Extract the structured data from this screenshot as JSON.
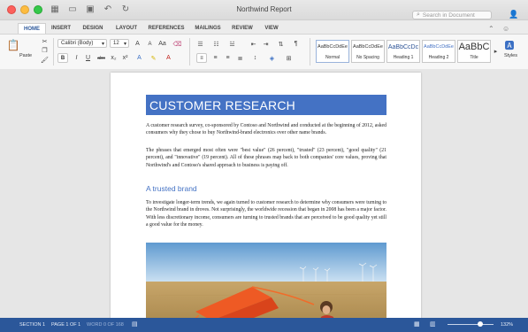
{
  "window": {
    "title": "Northwind Report"
  },
  "search": {
    "placeholder": "Search in Document"
  },
  "tabs": [
    {
      "label": "HOME"
    },
    {
      "label": "INSERT"
    },
    {
      "label": "DESIGN"
    },
    {
      "label": "LAYOUT"
    },
    {
      "label": "REFERENCES"
    },
    {
      "label": "MAILINGS"
    },
    {
      "label": "REVIEW"
    },
    {
      "label": "VIEW"
    }
  ],
  "ribbon": {
    "paste_label": "Paste",
    "font_name": "Calibri (Body)",
    "font_size": "12",
    "styles_label": "Styles",
    "style_gallery": [
      {
        "sample": "AaBbCcDdEe",
        "name": "Normal"
      },
      {
        "sample": "AaBbCcDdEe",
        "name": "No Spacing"
      },
      {
        "sample": "AaBbCcDc",
        "name": "Heading 1"
      },
      {
        "sample": "AaBbCcDdEe",
        "name": "Heading 2"
      },
      {
        "sample": "AaBbC",
        "name": "Title"
      }
    ]
  },
  "document": {
    "heading": "CUSTOMER RESEARCH",
    "p1": "A customer research survey, co-sponsored by Contoso and Northwind and conducted at the beginning of 2012, asked consumers why they chose to buy Northwind-brand electronics over other name brands.",
    "p2": "The phrases that emerged most often were \"best value\" (26 percent), \"trusted\" (23 percent), \"good quality\" (21 percent), and \"innovative\" (19 percent). All of these phrases map back to both companies' core values, proving that Northwind's and Contoso's shared approach to business is paying off.",
    "subheading": "A trusted brand",
    "p3": "To investigate longer-term trends, we again turned to customer research to determine why consumers were turning to the Northwind brand in droves. Not surprisingly, the worldwide recession that began in 2008 has been a major factor. With less discretionary income, consumers are turning to trusted brands that are perceived to be good quality yet still a good value for the money."
  },
  "status": {
    "section": "SECTION 1",
    "page": "PAGE 1 OF 1",
    "words": "WORD 0 OF 168",
    "zoom": "132%",
    "zoom_level": 0.72
  },
  "colors": {
    "accent": "#2b579a",
    "heading_fill": "#4472c4"
  }
}
